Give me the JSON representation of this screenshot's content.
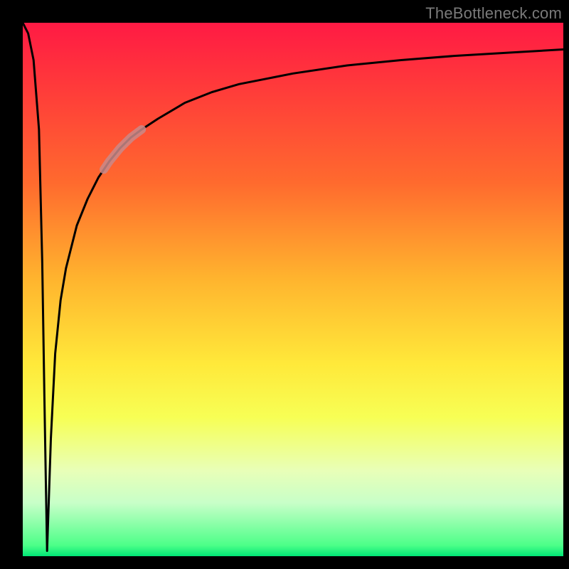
{
  "watermark": "TheBottleneck.com",
  "colors": {
    "curve": "#000000",
    "highlight": "#c98a8a",
    "background_top": "#ff1a44",
    "background_bottom": "#00e676",
    "frame": "#000000"
  },
  "chart_data": {
    "type": "line",
    "title": "",
    "xlabel": "",
    "ylabel": "",
    "xlim": [
      0,
      100
    ],
    "ylim": [
      0,
      100
    ],
    "grid": false,
    "legend": false,
    "notes": "No numeric axis ticks or labels are present in the image; data points are estimated from pixel positions. Curve shows a sharp drop near x≈4, a cusp at y≈0 around x≈4.5, then a steep rise flattening toward y≈95 at the right edge. A short semi-transparent highlight segment overlays the curve roughly between x≈15 and x≈22.",
    "series": [
      {
        "name": "bottleneck-curve",
        "x": [
          0,
          1,
          2,
          3,
          3.6,
          4.0,
          4.3,
          4.5,
          4.8,
          5.2,
          6,
          7,
          8,
          9,
          10,
          12,
          14,
          16,
          18,
          20,
          22,
          25,
          30,
          35,
          40,
          50,
          60,
          70,
          80,
          90,
          100
        ],
        "y": [
          100,
          98,
          93,
          80,
          55,
          30,
          12,
          1,
          10,
          22,
          38,
          48,
          54,
          58,
          62,
          67,
          71,
          74,
          76.5,
          78.5,
          80,
          82,
          85,
          87,
          88.5,
          90.5,
          92,
          93,
          93.8,
          94.4,
          95
        ]
      },
      {
        "name": "highlight-segment",
        "x": [
          15,
          16,
          18,
          20,
          22
        ],
        "y": [
          72.5,
          74,
          76.5,
          78.5,
          80
        ]
      }
    ]
  }
}
